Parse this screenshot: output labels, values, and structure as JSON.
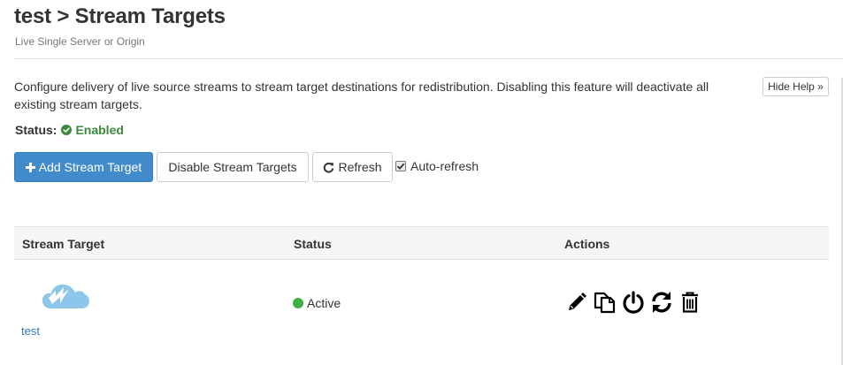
{
  "header": {
    "title": "test > Stream Targets",
    "subtitle": "Live Single Server or Origin"
  },
  "help": {
    "text": "Configure delivery of live source streams to stream target destinations for redistribution. Disabling this feature will deactivate all existing stream targets.",
    "hide_label": "Hide Help »"
  },
  "status": {
    "label": "Status:",
    "value": "Enabled",
    "icon": "check-circle-icon",
    "color": "#3c8a3c"
  },
  "toolbar": {
    "add_label": "Add Stream Target",
    "disable_label": "Disable Stream Targets",
    "refresh_label": "Refresh",
    "autorefresh_label": "Auto-refresh",
    "autorefresh_checked": true
  },
  "table": {
    "columns": [
      "Stream Target",
      "Status",
      "Actions"
    ],
    "rows": [
      {
        "name": "test",
        "icon": "wowza-cloud-icon",
        "status": "Active",
        "status_color": "#3cb043",
        "actions": [
          "edit-icon",
          "copy-icon",
          "power-icon",
          "refresh-icon",
          "trash-icon"
        ]
      }
    ]
  },
  "colors": {
    "primary": "#428bca",
    "link": "#337ab7",
    "success": "#3c8a3c"
  }
}
